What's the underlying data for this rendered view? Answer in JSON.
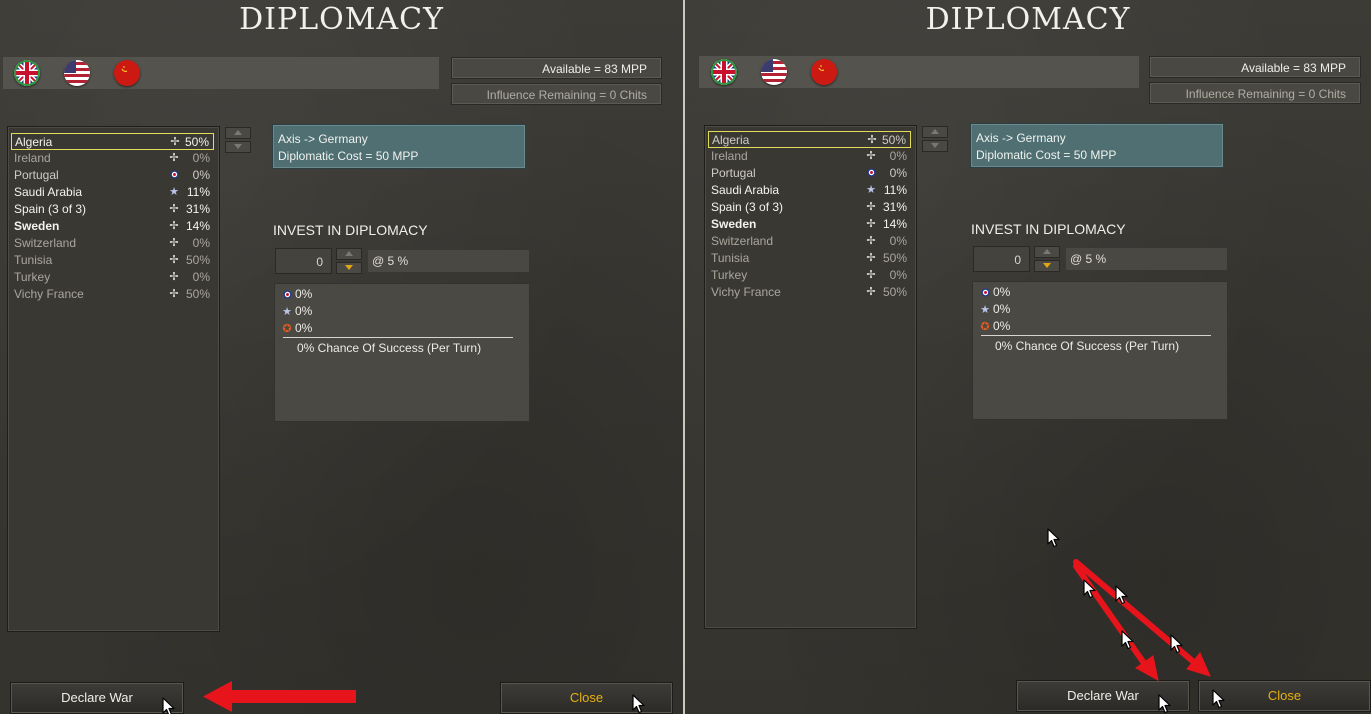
{
  "panels": [
    {
      "title": "DIPLOMACY",
      "available": "Available = 83 MPP",
      "influence": "Influence Remaining = 0 Chits",
      "countries": [
        {
          "name": "Algeria",
          "icon": "axis-cross",
          "pct": "50%"
        },
        {
          "name": "Ireland",
          "icon": "axis-cross",
          "pct": "0%"
        },
        {
          "name": "Portugal",
          "icon": "uk-roundel",
          "pct": "0%"
        },
        {
          "name": "Saudi Arabia",
          "icon": "us-star",
          "pct": "11%"
        },
        {
          "name": "Spain (3 of 3)",
          "icon": "axis-cross",
          "pct": "31%"
        },
        {
          "name": "Sweden",
          "icon": "axis-cross",
          "pct": "14%"
        },
        {
          "name": "Switzerland",
          "icon": "axis-cross",
          "pct": "0%"
        },
        {
          "name": "Tunisia",
          "icon": "axis-cross",
          "pct": "50%"
        },
        {
          "name": "Turkey",
          "icon": "axis-cross",
          "pct": "0%"
        },
        {
          "name": "Vichy France",
          "icon": "axis-cross",
          "pct": "50%"
        }
      ],
      "target_line1": "Axis -> Germany",
      "target_line2": "Diplomatic Cost = 50 MPP",
      "invest_title": "INVEST IN DIPLOMACY",
      "invest_value": "0",
      "invest_rate": "@ 5 %",
      "results": [
        {
          "icon": "uk-roundel",
          "value": "0%"
        },
        {
          "icon": "us-star",
          "value": "0%"
        },
        {
          "icon": "soviet-star",
          "value": "0%"
        }
      ],
      "chance": "0% Chance Of Success (Per Turn)",
      "declare_label": "Declare War",
      "close_label": "Close"
    },
    {
      "title": "DIPLOMACY",
      "available": "Available = 83 MPP",
      "influence": "Influence Remaining = 0 Chits",
      "countries": [
        {
          "name": "Algeria",
          "icon": "axis-cross",
          "pct": "50%"
        },
        {
          "name": "Ireland",
          "icon": "axis-cross",
          "pct": "0%"
        },
        {
          "name": "Portugal",
          "icon": "uk-roundel",
          "pct": "0%"
        },
        {
          "name": "Saudi Arabia",
          "icon": "us-star",
          "pct": "11%"
        },
        {
          "name": "Spain (3 of 3)",
          "icon": "axis-cross",
          "pct": "31%"
        },
        {
          "name": "Sweden",
          "icon": "axis-cross",
          "pct": "14%"
        },
        {
          "name": "Switzerland",
          "icon": "axis-cross",
          "pct": "0%"
        },
        {
          "name": "Tunisia",
          "icon": "axis-cross",
          "pct": "50%"
        },
        {
          "name": "Turkey",
          "icon": "axis-cross",
          "pct": "0%"
        },
        {
          "name": "Vichy France",
          "icon": "axis-cross",
          "pct": "50%"
        }
      ],
      "target_line1": "Axis -> Germany",
      "target_line2": "Diplomatic Cost = 50 MPP",
      "invest_title": "INVEST IN DIPLOMACY",
      "invest_value": "0",
      "invest_rate": "@ 5 %",
      "results": [
        {
          "icon": "uk-roundel",
          "value": "0%"
        },
        {
          "icon": "us-star",
          "value": "0%"
        },
        {
          "icon": "soviet-star",
          "value": "0%"
        }
      ],
      "chance": "0% Chance Of Success (Per Turn)",
      "declare_label": "Declare War",
      "close_label": "Close"
    }
  ],
  "colors": {
    "selection_border": "#e3dc5a",
    "close_text": "#e7b10f",
    "annotation_arrow": "#e8141c",
    "target_box": "#4f6f73"
  }
}
